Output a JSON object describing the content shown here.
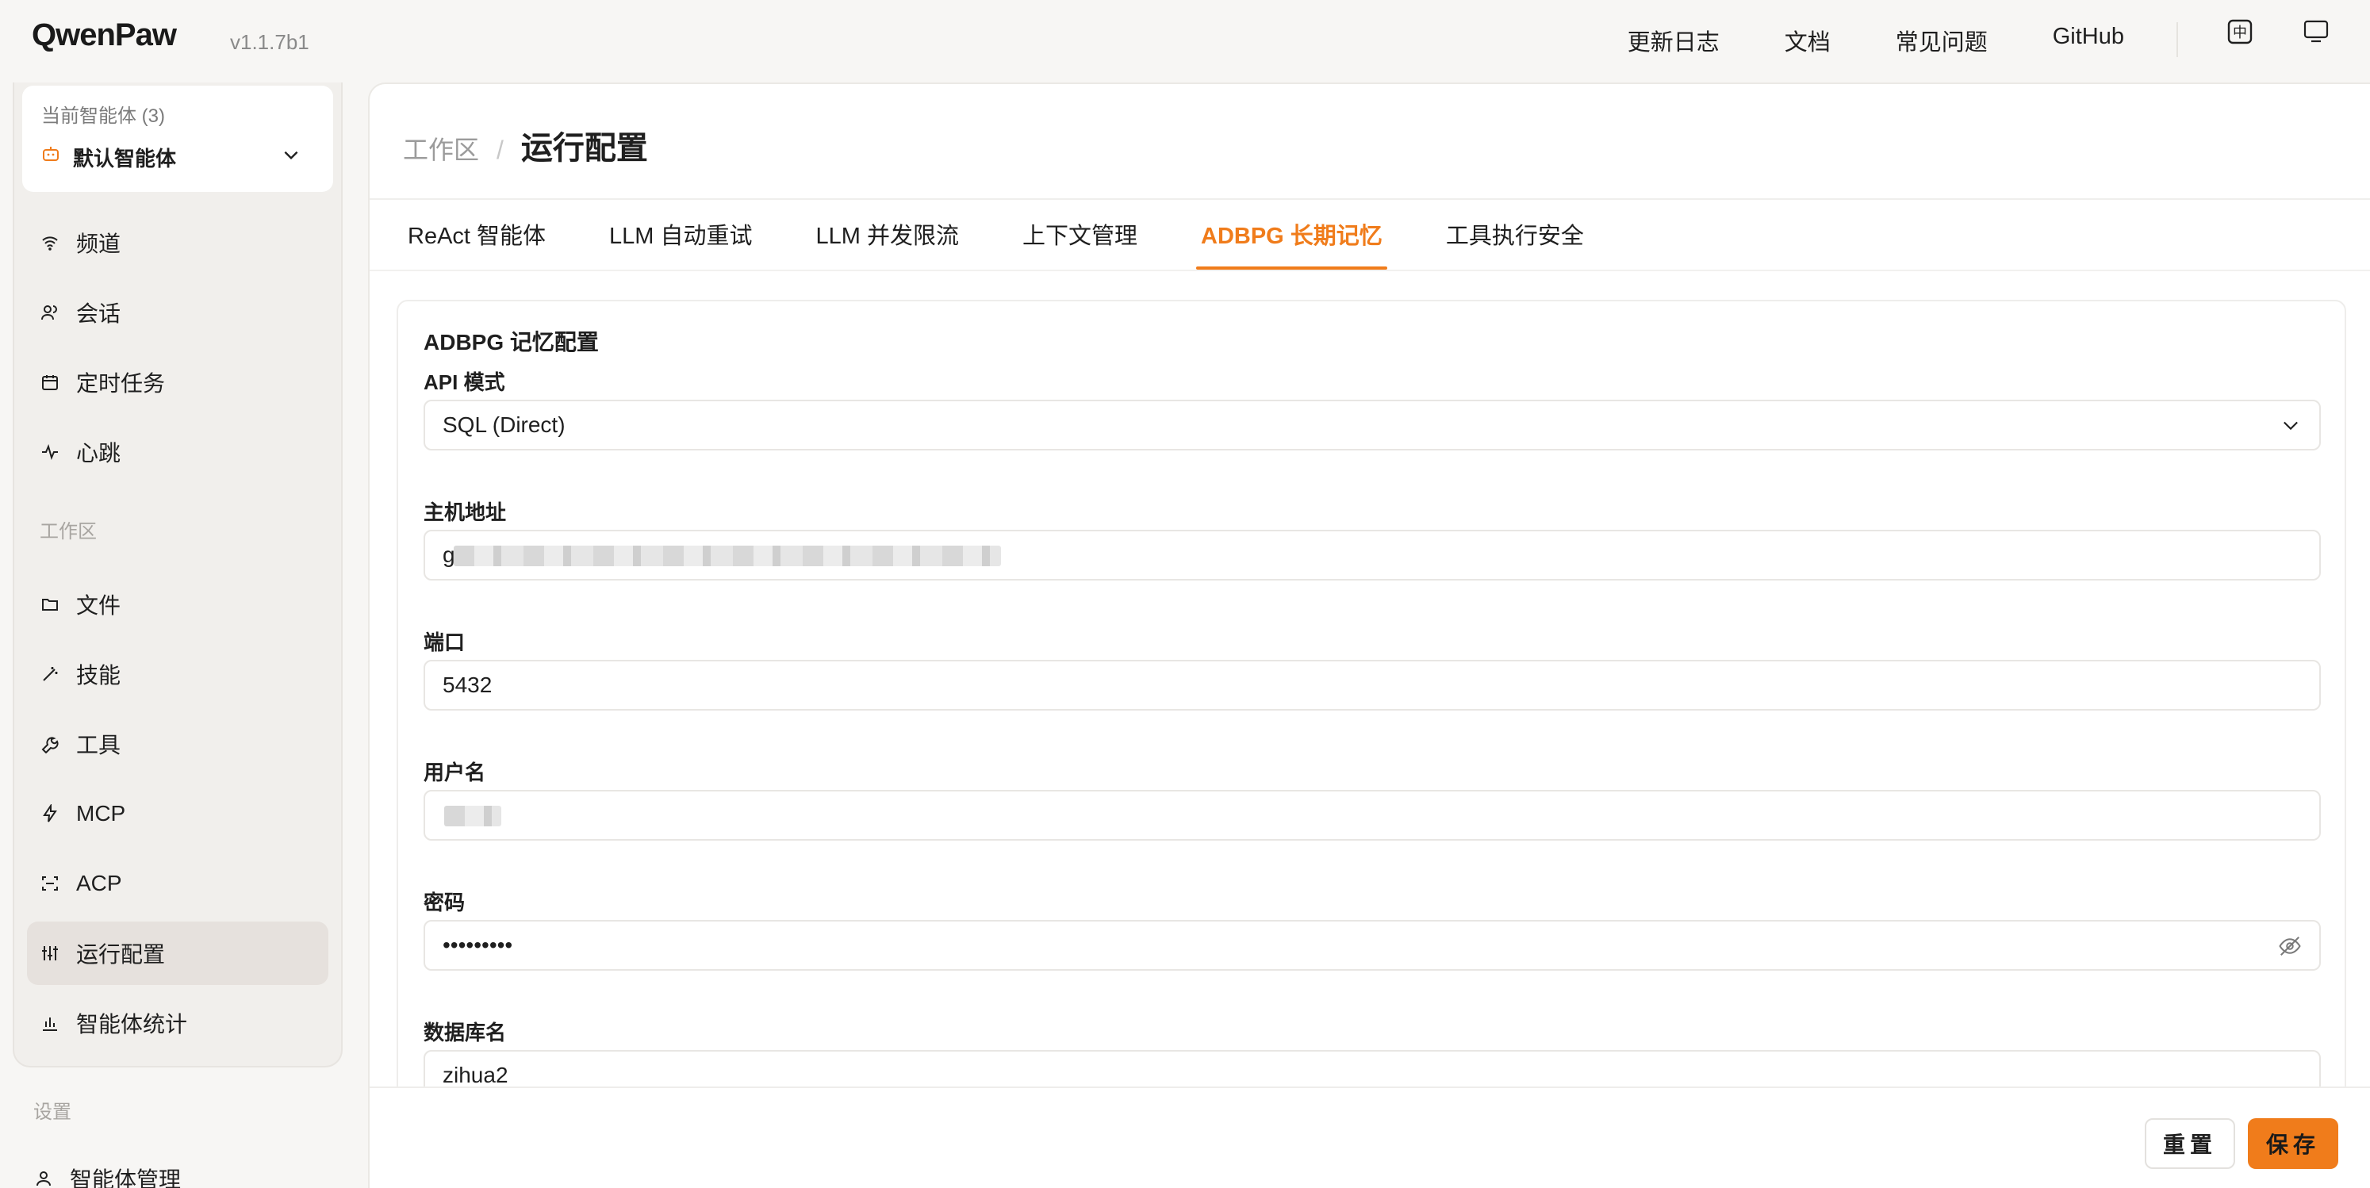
{
  "app": {
    "name": "QwenPaw",
    "version": "v1.1.7b1"
  },
  "header": {
    "links": [
      "更新日志",
      "文档",
      "常见问题",
      "GitHub"
    ],
    "icons": [
      "language-toggle-icon",
      "display-icon"
    ],
    "lang_glyph": "中"
  },
  "sidebar": {
    "agent": {
      "count_label": "当前智能体 (3)",
      "name": "默认智能体"
    },
    "items_top": [
      "频道",
      "会话",
      "定时任务",
      "心跳"
    ],
    "section_workspace": "工作区",
    "items_workspace": [
      "文件",
      "技能",
      "工具",
      "MCP",
      "ACP",
      "运行配置",
      "智能体统计"
    ],
    "active_item": "运行配置",
    "section_settings": "设置",
    "items_settings": [
      "智能体管理"
    ]
  },
  "main": {
    "breadcrumb": {
      "root": "工作区",
      "sep": "/",
      "current": "运行配置"
    },
    "tabs": [
      "ReAct 智能体",
      "LLM 自动重试",
      "LLM 并发限流",
      "上下文管理",
      "ADBPG 长期记忆",
      "工具执行安全"
    ],
    "active_tab": "ADBPG 长期记忆",
    "form": {
      "title": "ADBPG 记忆配置",
      "api_mode": {
        "label": "API 模式",
        "value": "SQL (Direct)"
      },
      "host": {
        "label": "主机地址",
        "value": "g"
      },
      "port": {
        "label": "端口",
        "value": "5432"
      },
      "username": {
        "label": "用户名",
        "value": ""
      },
      "password": {
        "label": "密码",
        "value": "•••••••••"
      },
      "database": {
        "label": "数据库名",
        "value": "zihua2"
      }
    },
    "buttons": {
      "reset": "重置",
      "save": "保存"
    }
  },
  "colors": {
    "accent": "#f07c1b",
    "active_bg": "#e6e1dd"
  }
}
